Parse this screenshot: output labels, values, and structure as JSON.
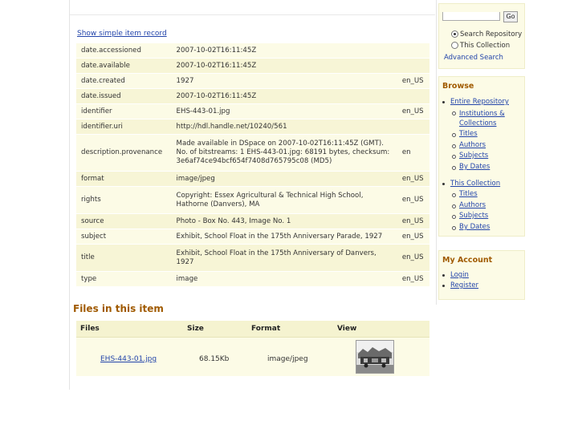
{
  "item": {
    "show_simple_label": "Show simple item record",
    "metadata": [
      {
        "key": "date.accessioned",
        "value": "2007-10-02T16:11:45Z",
        "lang": ""
      },
      {
        "key": "date.available",
        "value": "2007-10-02T16:11:45Z",
        "lang": ""
      },
      {
        "key": "date.created",
        "value": "1927",
        "lang": "en_US"
      },
      {
        "key": "date.issued",
        "value": "2007-10-02T16:11:45Z",
        "lang": ""
      },
      {
        "key": "identifier",
        "value": "EHS-443-01.jpg",
        "lang": "en_US"
      },
      {
        "key": "identifier.uri",
        "value": "http://hdl.handle.net/10240/561",
        "lang": ""
      },
      {
        "key": "description.provenance",
        "value": "Made available in DSpace on 2007-10-02T16:11:45Z (GMT). No. of bitstreams: 1 EHS-443-01.jpg: 68191 bytes, checksum: 3e6af74ce94bcf654f7408d765795c08 (MD5)",
        "lang": "en"
      },
      {
        "key": "format",
        "value": "image/jpeg",
        "lang": "en_US"
      },
      {
        "key": "rights",
        "value": "Copyright: Essex Agricultural & Technical High School, Hathorne (Danvers), MA",
        "lang": "en_US"
      },
      {
        "key": "source",
        "value": "Photo - Box No. 443, Image No. 1",
        "lang": "en_US"
      },
      {
        "key": "subject",
        "value": "Exhibit, School Float in the 175th Anniversary Parade, 1927",
        "lang": "en_US"
      },
      {
        "key": "title",
        "value": "Exhibit, School Float in the 175th Anniversary of Danvers, 1927",
        "lang": "en_US"
      },
      {
        "key": "type",
        "value": "image",
        "lang": "en_US"
      }
    ]
  },
  "files": {
    "heading": "Files in this item",
    "columns": [
      "Files",
      "Size",
      "Format",
      "View"
    ],
    "rows": [
      {
        "name": "EHS-443-01.jpg",
        "size": "68.15Kb",
        "format": "image/jpeg"
      }
    ]
  },
  "sidebar": {
    "search": {
      "go_label": "Go",
      "scope_repository": "Search Repository",
      "scope_collection": "This Collection",
      "advanced": "Advanced Search"
    },
    "browse": {
      "title": "Browse",
      "entire_repo": "Entire Repository",
      "repo_links": [
        "Institutions & Collections",
        "Titles",
        "Authors",
        "Subjects",
        "By Dates"
      ],
      "this_collection": "This Collection",
      "coll_links": [
        "Titles",
        "Authors",
        "Subjects",
        "By Dates"
      ]
    },
    "account": {
      "title": "My Account",
      "links": [
        "Login",
        "Register"
      ]
    }
  }
}
